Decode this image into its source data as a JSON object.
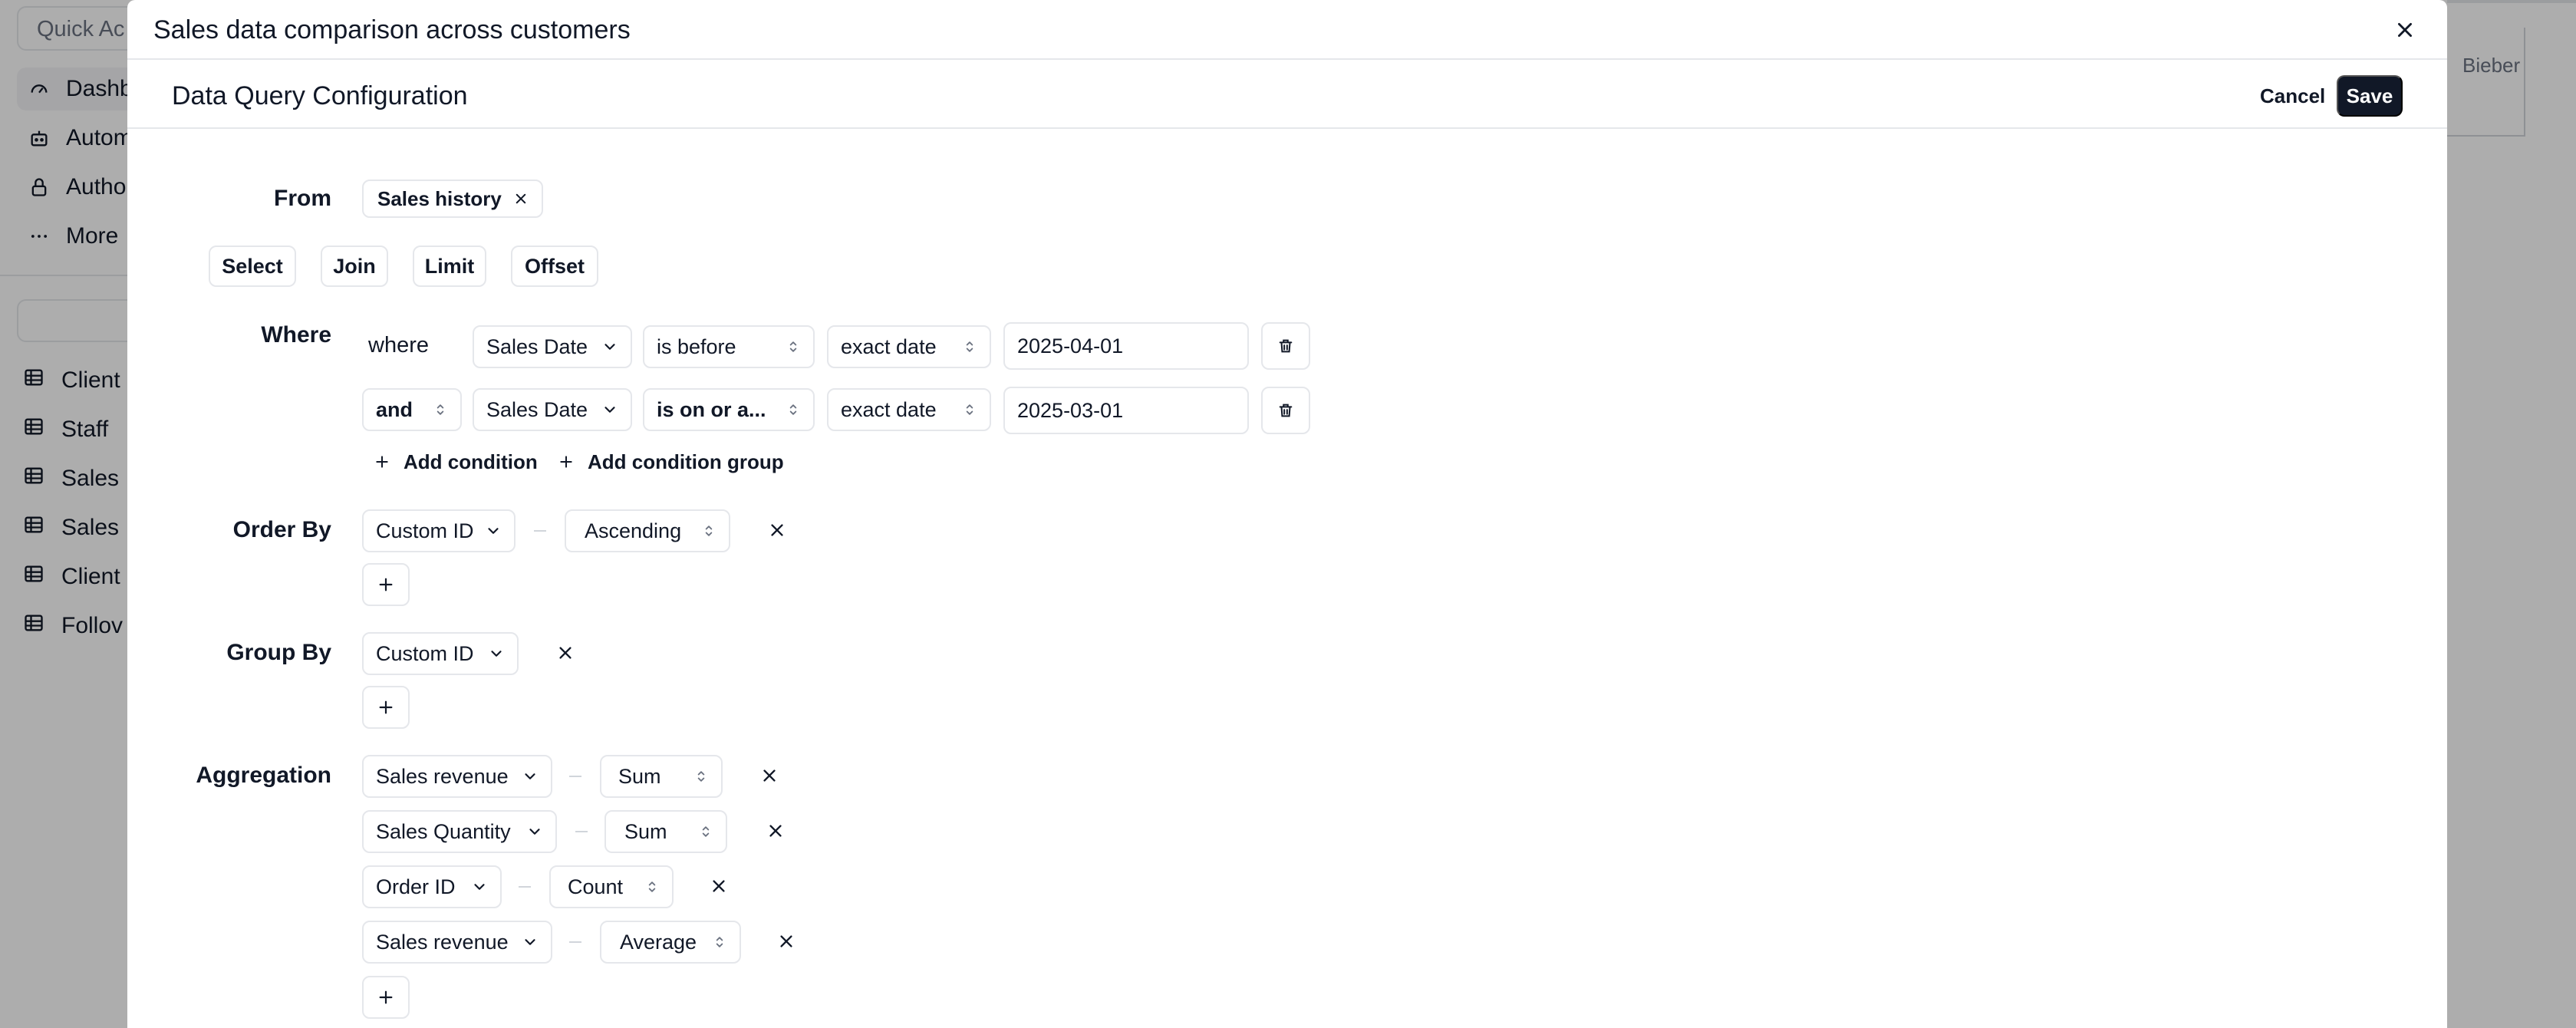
{
  "background": {
    "quick_actions_placeholder": "Quick Ac",
    "nav": [
      {
        "label": "Dashb",
        "icon": "gauge-icon"
      },
      {
        "label": "Autom",
        "icon": "robot-icon"
      },
      {
        "label": "Author",
        "icon": "lock-icon"
      },
      {
        "label": "More",
        "icon": "more-icon"
      }
    ],
    "tables": [
      "Client",
      "Staff",
      "Sales",
      "Sales",
      "Client",
      "Follov"
    ],
    "right_text": "Bieber"
  },
  "modal": {
    "title": "Sales data comparison across customers",
    "subtitle": "Data Query Configuration",
    "cancel_label": "Cancel",
    "save_label": "Save"
  },
  "query": {
    "from_label": "From",
    "from_table": "Sales history",
    "clause_buttons": [
      "Select",
      "Join",
      "Limit",
      "Offset"
    ],
    "where_label": "Where",
    "conditions": [
      {
        "connector": "where",
        "field": "Sales Date",
        "operator": "is before",
        "mode": "exact date",
        "value": "2025-04-01"
      },
      {
        "connector": "and",
        "field": "Sales Date",
        "operator": "is on or a...",
        "mode": "exact date",
        "value": "2025-03-01"
      }
    ],
    "add_condition_label": "Add condition",
    "add_condition_group_label": "Add condition group",
    "order_by_label": "Order By",
    "order_by": [
      {
        "field": "Custom ID",
        "direction": "Ascending"
      }
    ],
    "group_by_label": "Group By",
    "group_by": [
      {
        "field": "Custom ID"
      }
    ],
    "aggregation_label": "Aggregation",
    "aggregations": [
      {
        "field": "Sales revenue",
        "function": "Sum"
      },
      {
        "field": "Sales Quantity",
        "function": "Sum"
      },
      {
        "field": "Order ID",
        "function": "Count"
      },
      {
        "field": "Sales revenue",
        "function": "Average"
      }
    ]
  }
}
